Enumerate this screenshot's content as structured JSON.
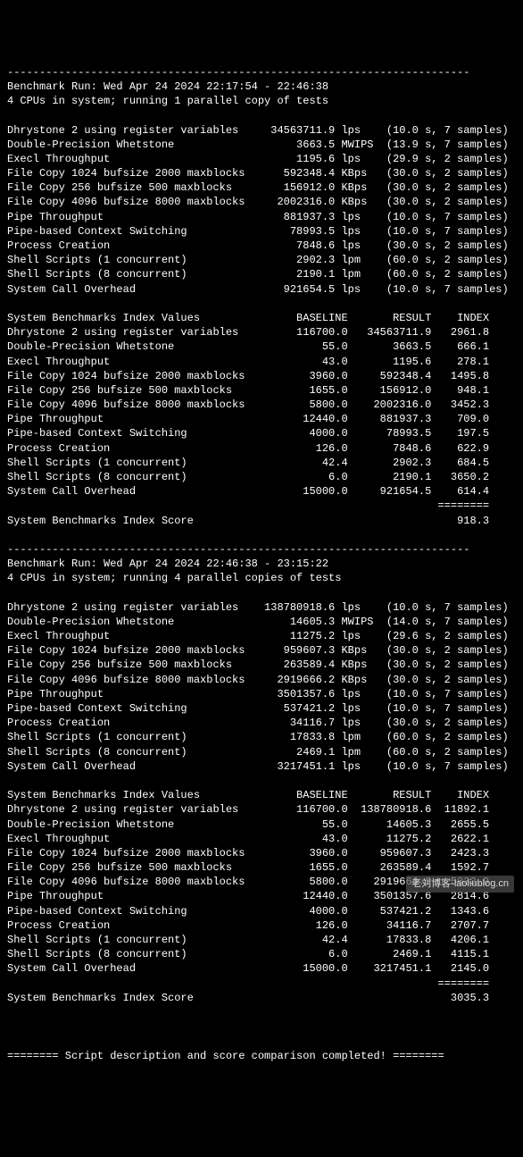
{
  "run1": {
    "header1": "Benchmark Run: Wed Apr 24 2024 22:17:54 - 22:46:38",
    "header2": "4 CPUs in system; running 1 parallel copy of tests",
    "tests": [
      {
        "name": "Dhrystone 2 using register variables",
        "val": "34563711.9",
        "unit": "lps",
        "time": "10.0",
        "samples": "7"
      },
      {
        "name": "Double-Precision Whetstone",
        "val": "3663.5",
        "unit": "MWIPS",
        "time": "13.9",
        "samples": "7"
      },
      {
        "name": "Execl Throughput",
        "val": "1195.6",
        "unit": "lps",
        "time": "29.9",
        "samples": "2"
      },
      {
        "name": "File Copy 1024 bufsize 2000 maxblocks",
        "val": "592348.4",
        "unit": "KBps",
        "time": "30.0",
        "samples": "2"
      },
      {
        "name": "File Copy 256 bufsize 500 maxblocks",
        "val": "156912.0",
        "unit": "KBps",
        "time": "30.0",
        "samples": "2"
      },
      {
        "name": "File Copy 4096 bufsize 8000 maxblocks",
        "val": "2002316.0",
        "unit": "KBps",
        "time": "30.0",
        "samples": "2"
      },
      {
        "name": "Pipe Throughput",
        "val": "881937.3",
        "unit": "lps",
        "time": "10.0",
        "samples": "7"
      },
      {
        "name": "Pipe-based Context Switching",
        "val": "78993.5",
        "unit": "lps",
        "time": "10.0",
        "samples": "7"
      },
      {
        "name": "Process Creation",
        "val": "7848.6",
        "unit": "lps",
        "time": "30.0",
        "samples": "2"
      },
      {
        "name": "Shell Scripts (1 concurrent)",
        "val": "2902.3",
        "unit": "lpm",
        "time": "60.0",
        "samples": "2"
      },
      {
        "name": "Shell Scripts (8 concurrent)",
        "val": "2190.1",
        "unit": "lpm",
        "time": "60.0",
        "samples": "2"
      },
      {
        "name": "System Call Overhead",
        "val": "921654.5",
        "unit": "lps",
        "time": "10.0",
        "samples": "7"
      }
    ],
    "index_header": "System Benchmarks Index Values               BASELINE       RESULT    INDEX",
    "index": [
      {
        "name": "Dhrystone 2 using register variables",
        "base": "116700.0",
        "res": "34563711.9",
        "idx": "2961.8"
      },
      {
        "name": "Double-Precision Whetstone",
        "base": "55.0",
        "res": "3663.5",
        "idx": "666.1"
      },
      {
        "name": "Execl Throughput",
        "base": "43.0",
        "res": "1195.6",
        "idx": "278.1"
      },
      {
        "name": "File Copy 1024 bufsize 2000 maxblocks",
        "base": "3960.0",
        "res": "592348.4",
        "idx": "1495.8"
      },
      {
        "name": "File Copy 256 bufsize 500 maxblocks",
        "base": "1655.0",
        "res": "156912.0",
        "idx": "948.1"
      },
      {
        "name": "File Copy 4096 bufsize 8000 maxblocks",
        "base": "5800.0",
        "res": "2002316.0",
        "idx": "3452.3"
      },
      {
        "name": "Pipe Throughput",
        "base": "12440.0",
        "res": "881937.3",
        "idx": "709.0"
      },
      {
        "name": "Pipe-based Context Switching",
        "base": "4000.0",
        "res": "78993.5",
        "idx": "197.5"
      },
      {
        "name": "Process Creation",
        "base": "126.0",
        "res": "7848.6",
        "idx": "622.9"
      },
      {
        "name": "Shell Scripts (1 concurrent)",
        "base": "42.4",
        "res": "2902.3",
        "idx": "684.5"
      },
      {
        "name": "Shell Scripts (8 concurrent)",
        "base": "6.0",
        "res": "2190.1",
        "idx": "3650.2"
      },
      {
        "name": "System Call Overhead",
        "base": "15000.0",
        "res": "921654.5",
        "idx": "614.4"
      }
    ],
    "score_label": "System Benchmarks Index Score",
    "score": "918.3"
  },
  "run2": {
    "header1": "Benchmark Run: Wed Apr 24 2024 22:46:38 - 23:15:22",
    "header2": "4 CPUs in system; running 4 parallel copies of tests",
    "tests": [
      {
        "name": "Dhrystone 2 using register variables",
        "val": "138780918.6",
        "unit": "lps",
        "time": "10.0",
        "samples": "7"
      },
      {
        "name": "Double-Precision Whetstone",
        "val": "14605.3",
        "unit": "MWIPS",
        "time": "14.0",
        "samples": "7"
      },
      {
        "name": "Execl Throughput",
        "val": "11275.2",
        "unit": "lps",
        "time": "29.6",
        "samples": "2"
      },
      {
        "name": "File Copy 1024 bufsize 2000 maxblocks",
        "val": "959607.3",
        "unit": "KBps",
        "time": "30.0",
        "samples": "2"
      },
      {
        "name": "File Copy 256 bufsize 500 maxblocks",
        "val": "263589.4",
        "unit": "KBps",
        "time": "30.0",
        "samples": "2"
      },
      {
        "name": "File Copy 4096 bufsize 8000 maxblocks",
        "val": "2919666.2",
        "unit": "KBps",
        "time": "30.0",
        "samples": "2"
      },
      {
        "name": "Pipe Throughput",
        "val": "3501357.6",
        "unit": "lps",
        "time": "10.0",
        "samples": "7"
      },
      {
        "name": "Pipe-based Context Switching",
        "val": "537421.2",
        "unit": "lps",
        "time": "10.0",
        "samples": "7"
      },
      {
        "name": "Process Creation",
        "val": "34116.7",
        "unit": "lps",
        "time": "30.0",
        "samples": "2"
      },
      {
        "name": "Shell Scripts (1 concurrent)",
        "val": "17833.8",
        "unit": "lpm",
        "time": "60.0",
        "samples": "2"
      },
      {
        "name": "Shell Scripts (8 concurrent)",
        "val": "2469.1",
        "unit": "lpm",
        "time": "60.0",
        "samples": "2"
      },
      {
        "name": "System Call Overhead",
        "val": "3217451.1",
        "unit": "lps",
        "time": "10.0",
        "samples": "7"
      }
    ],
    "index_header": "System Benchmarks Index Values               BASELINE       RESULT    INDEX",
    "index": [
      {
        "name": "Dhrystone 2 using register variables",
        "base": "116700.0",
        "res": "138780918.6",
        "idx": "11892.1"
      },
      {
        "name": "Double-Precision Whetstone",
        "base": "55.0",
        "res": "14605.3",
        "idx": "2655.5"
      },
      {
        "name": "Execl Throughput",
        "base": "43.0",
        "res": "11275.2",
        "idx": "2622.1"
      },
      {
        "name": "File Copy 1024 bufsize 2000 maxblocks",
        "base": "3960.0",
        "res": "959607.3",
        "idx": "2423.3"
      },
      {
        "name": "File Copy 256 bufsize 500 maxblocks",
        "base": "1655.0",
        "res": "263589.4",
        "idx": "1592.7"
      },
      {
        "name": "File Copy 4096 bufsize 8000 maxblocks",
        "base": "5800.0",
        "res": "2919666.2",
        "idx": "5033.9"
      },
      {
        "name": "Pipe Throughput",
        "base": "12440.0",
        "res": "3501357.6",
        "idx": "2814.6"
      },
      {
        "name": "Pipe-based Context Switching",
        "base": "4000.0",
        "res": "537421.2",
        "idx": "1343.6"
      },
      {
        "name": "Process Creation",
        "base": "126.0",
        "res": "34116.7",
        "idx": "2707.7"
      },
      {
        "name": "Shell Scripts (1 concurrent)",
        "base": "42.4",
        "res": "17833.8",
        "idx": "4206.1"
      },
      {
        "name": "Shell Scripts (8 concurrent)",
        "base": "6.0",
        "res": "2469.1",
        "idx": "4115.1"
      },
      {
        "name": "System Call Overhead",
        "base": "15000.0",
        "res": "3217451.1",
        "idx": "2145.0"
      }
    ],
    "score_label": "System Benchmarks Index Score",
    "score": "3035.3"
  },
  "hr": "------------------------------------------------------------------------",
  "eqshort": "========",
  "footer": "======== Script description and score comparison completed! ========",
  "watermark": "老刘博客-laoliublog.cn"
}
